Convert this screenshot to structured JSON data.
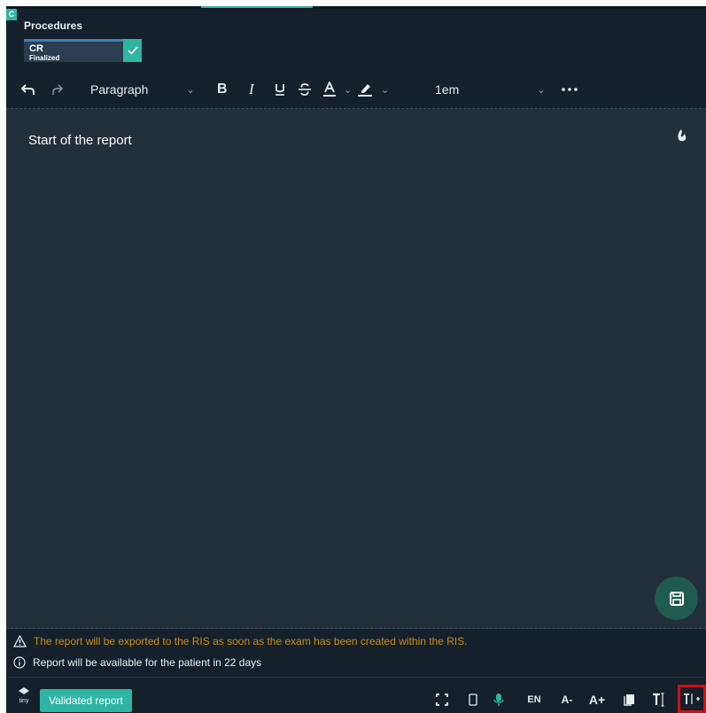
{
  "procedures": {
    "section_letter": "C",
    "title": "Procedures",
    "card": {
      "code": "CR",
      "status": "Finalized"
    }
  },
  "toolbar": {
    "block_format": "Paragraph",
    "font_size": "1em",
    "icons": [
      "undo-icon",
      "redo-icon",
      "bold-icon",
      "italic-icon",
      "underline-icon",
      "strikethrough-icon",
      "text-color-icon",
      "highlight-icon",
      "more-icon"
    ],
    "bold_label": "B",
    "italic_label": "I"
  },
  "editor": {
    "content": "Start of the report",
    "save_icon": "save-icon"
  },
  "notices": {
    "export_warning": "The report will be exported to the RIS as soon as the exam has been created within the RIS.",
    "patient_availability": "Report will be available for the patient in 22 days"
  },
  "statusbar": {
    "tiny_logo": "tiny",
    "validated_label": "Validated report",
    "language": "EN",
    "font_smaller": "A-",
    "font_larger": "A+",
    "icons": [
      "fullscreen-icon",
      "mobile-preview-icon",
      "microphone-icon",
      "copy-icon",
      "text-cursor-icon",
      "insert-text-icon"
    ]
  },
  "colors": {
    "accent": "#2fb5a3",
    "warning": "#c98d13",
    "highlight_border": "#d10f1b",
    "background": "#16202a",
    "editor_background": "#232f39"
  }
}
